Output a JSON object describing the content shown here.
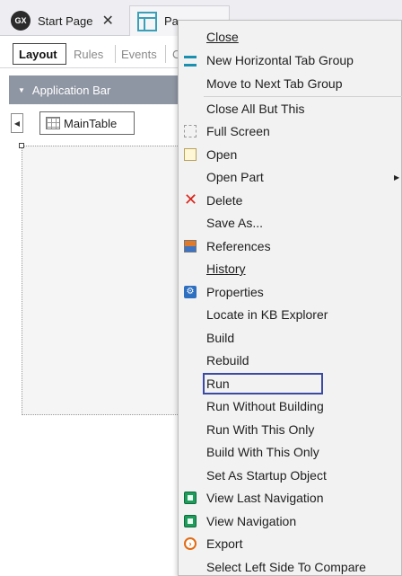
{
  "tabs": {
    "start_page": {
      "icon_text": "GX",
      "label": "Start Page"
    },
    "active_tab": {
      "label": "Pa"
    },
    "close_glyph": "✕"
  },
  "subtabs": {
    "layout": "Layout",
    "rules": "Rules",
    "events": "Events",
    "c": "C"
  },
  "appbar": {
    "label": "Application Bar"
  },
  "design": {
    "maintable_label": "MainTable"
  },
  "context_menu": {
    "items": [
      {
        "label": "Close",
        "icon": ""
      },
      {
        "label": "New Horizontal Tab Group",
        "icon": "horizontal-tab-group-icon"
      },
      {
        "label": "Move to Next Tab Group",
        "icon": ""
      },
      {
        "label": "Close All But This",
        "icon": ""
      },
      {
        "label": "Full Screen",
        "icon": "full-screen-icon"
      },
      {
        "label": "Open",
        "icon": "open-icon"
      },
      {
        "label": "Open Part",
        "icon": "",
        "submenu": true
      },
      {
        "label": "Delete",
        "icon": "delete-icon"
      },
      {
        "label": "Save As...",
        "icon": ""
      },
      {
        "label": "References",
        "icon": "references-icon"
      },
      {
        "label": "History",
        "icon": ""
      },
      {
        "label": "Properties",
        "icon": "properties-icon"
      },
      {
        "label": "Locate in KB Explorer",
        "icon": ""
      },
      {
        "label": "Build",
        "icon": ""
      },
      {
        "label": "Rebuild",
        "icon": ""
      },
      {
        "label": "Run",
        "icon": "",
        "highlighted": true
      },
      {
        "label": "Run Without Building",
        "icon": ""
      },
      {
        "label": "Run With This Only",
        "icon": ""
      },
      {
        "label": "Build With This Only",
        "icon": ""
      },
      {
        "label": "Set As Startup Object",
        "icon": ""
      },
      {
        "label": "View Last Navigation",
        "icon": "navigation-icon"
      },
      {
        "label": "View Navigation",
        "icon": "navigation-icon"
      },
      {
        "label": "Export",
        "icon": "export-icon"
      },
      {
        "label": "Select Left Side To Compare",
        "icon": ""
      }
    ]
  },
  "colors": {
    "highlight_border": "#3b4aa3",
    "menu_background": "#f2f2f2",
    "appbar_background": "#8f96a3"
  }
}
